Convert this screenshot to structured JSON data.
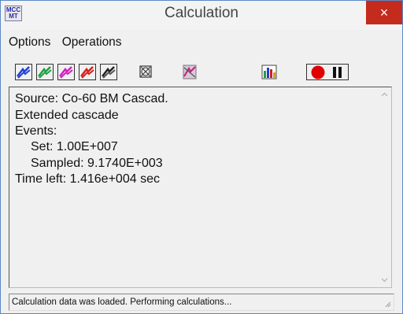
{
  "window": {
    "title": "Calculation",
    "icon_text": [
      "MCC",
      "MT"
    ],
    "close_glyph": "×"
  },
  "menu": {
    "items": [
      "Options",
      "Operations"
    ]
  },
  "toolbar": {
    "buttons": [
      "spectrum-blue-icon",
      "spectrum-green-icon",
      "spectrum-magenta-icon",
      "spectrum-red-icon",
      "spectrum-black-icon",
      "cross-box-icon",
      "spectrum-disabled-icon",
      "histogram-icon",
      "record-icon",
      "pause-icon"
    ]
  },
  "content": {
    "lines": [
      "Source: Co-60 BM Cascad.",
      "Extended cascade",
      "Events:",
      "Set: 1.00E+007",
      "Sampled: 9.1740E+003",
      "Time left: 1.416e+004 sec"
    ]
  },
  "status": {
    "text": "Calculation data was loaded. Performing calculations..."
  },
  "colors": {
    "close": "#c42b1c",
    "record": "#e00000",
    "blue": "#2040d0",
    "green": "#20a040",
    "magenta": "#d020c0",
    "red": "#d02020"
  }
}
